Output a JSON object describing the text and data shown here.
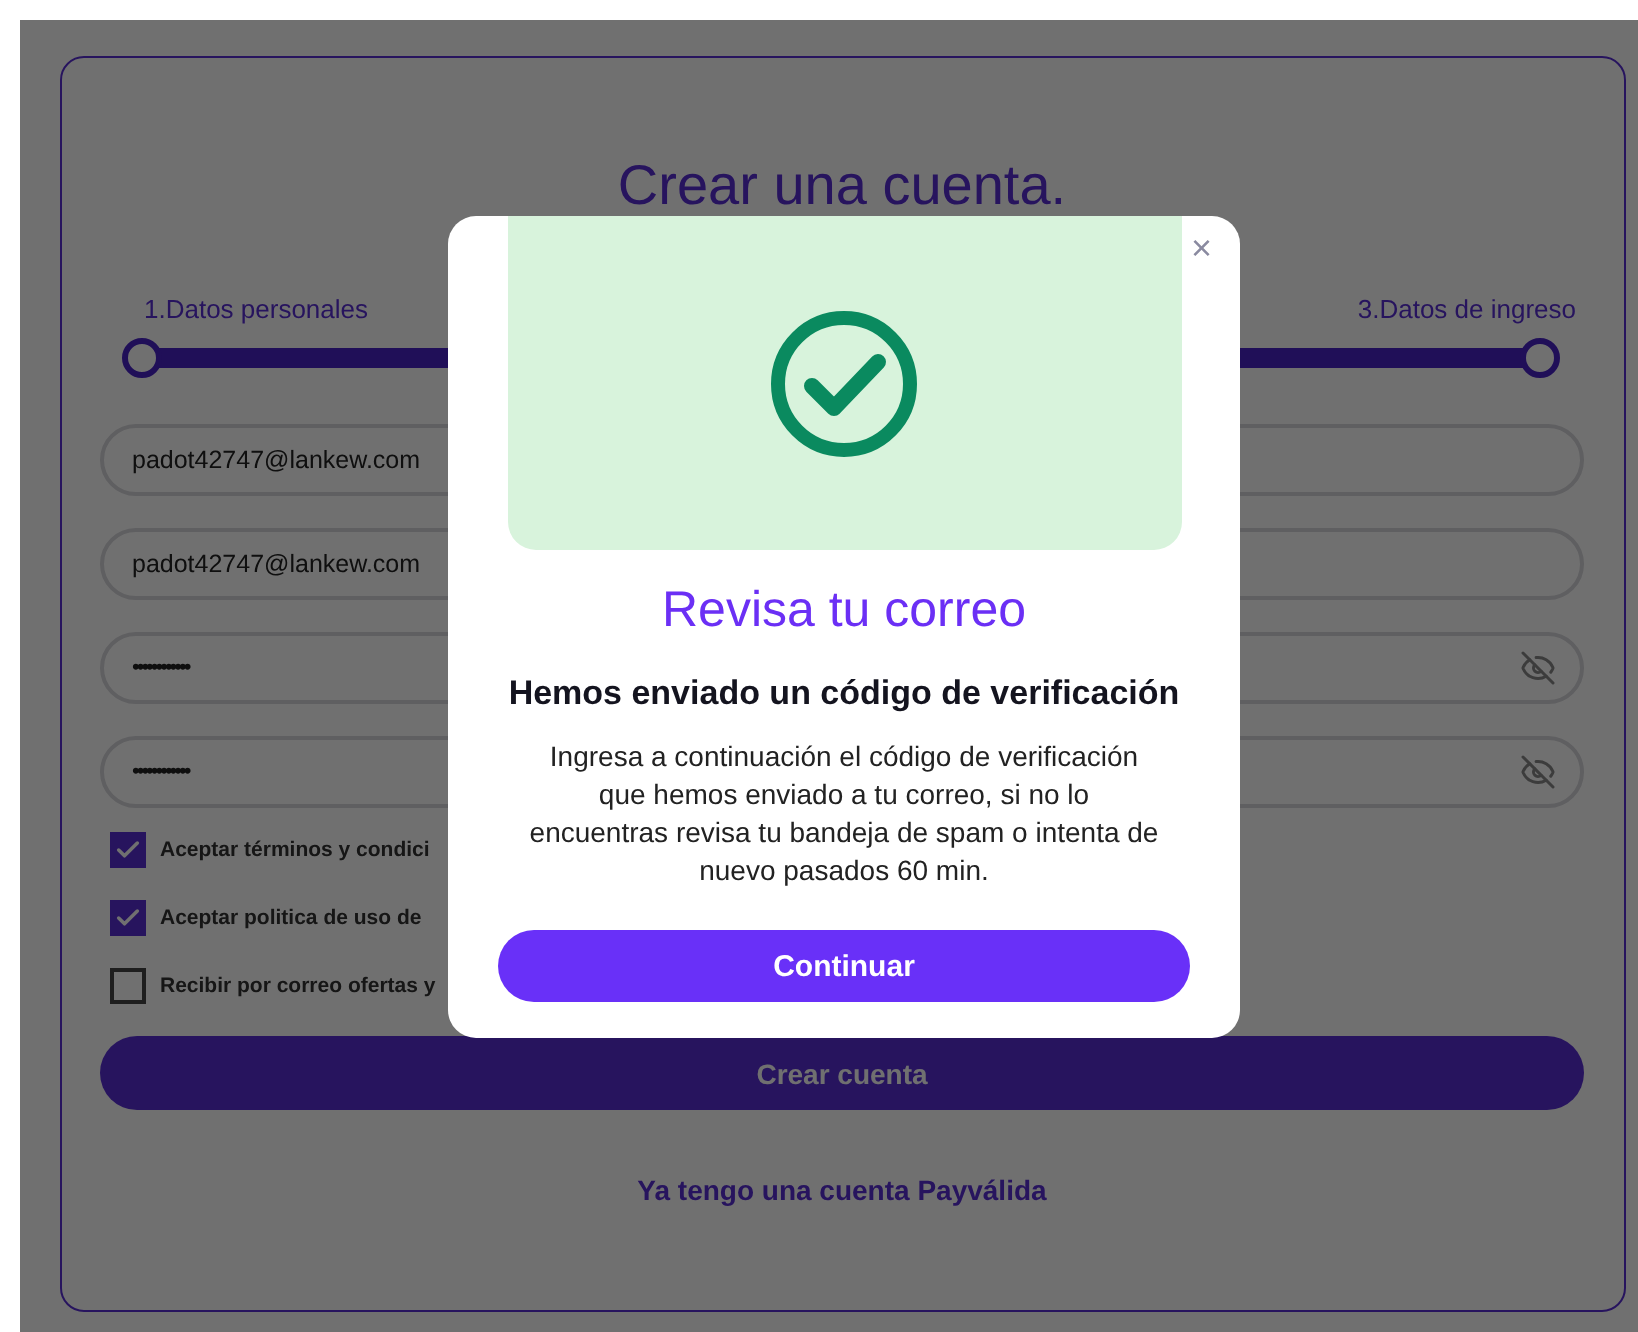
{
  "page": {
    "title": "Crear una cuenta.",
    "steps": [
      {
        "label": "1.Datos personales"
      },
      {
        "label": "3.Datos de ingreso"
      }
    ],
    "fields": [
      {
        "kind": "text",
        "value": "padot42747@lankew.com"
      },
      {
        "kind": "text",
        "value": "padot42747@lankew.com"
      },
      {
        "kind": "password",
        "value": "••••••••••••"
      },
      {
        "kind": "password",
        "value": "••••••••••••"
      }
    ],
    "checkboxes": [
      {
        "label": "Aceptar términos y condici",
        "checked": true
      },
      {
        "label": "Aceptar politica de uso de",
        "checked": true
      },
      {
        "label": "Recibir por correo ofertas y",
        "checked": false
      }
    ],
    "submit": "Crear cuenta",
    "login_link": "Ya tengo una cuenta Payválida"
  },
  "modal": {
    "title": "Revisa tu correo",
    "heading": "Hemos enviado un código de verificación",
    "body": "Ingresa a continuación el código de verificación que hemos enviado a tu correo, si no lo encuentras revisa tu bandeja de spam o intenta de nuevo pasados 60 min.",
    "button": "Continuar",
    "close": "×"
  }
}
